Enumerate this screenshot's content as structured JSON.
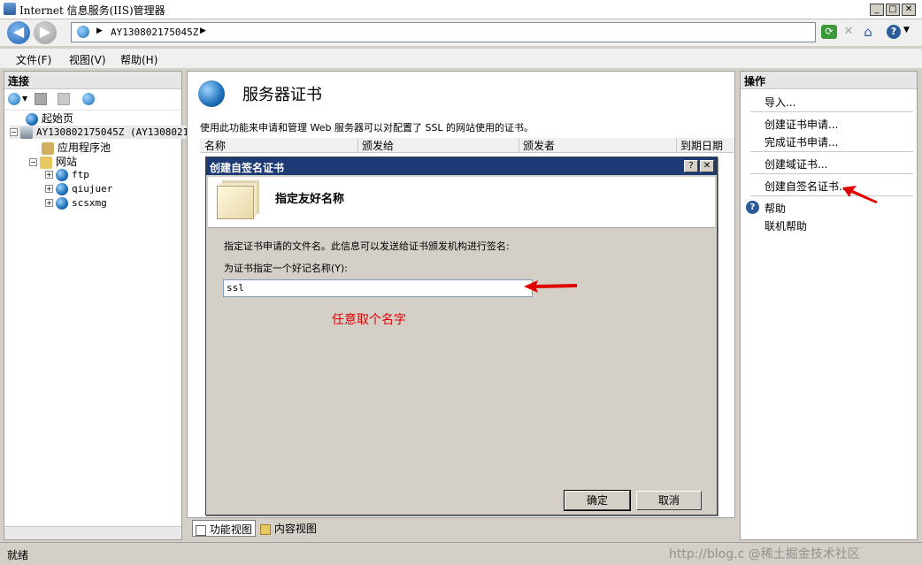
{
  "window": {
    "title": "Internet 信息服务(IIS)管理器"
  },
  "address_bar": {
    "path": "AY130802175045Z"
  },
  "menu": {
    "file": "文件(F)",
    "view": "视图(V)",
    "help": "帮助(H)"
  },
  "connections": {
    "header": "连接",
    "tree": {
      "start_page": "起始页",
      "server": "AY130802175045Z (AY1308021",
      "app_pools": "应用程序池",
      "sites": "网站",
      "site_items": [
        "ftp",
        "qiujuer",
        "scsxmg"
      ]
    }
  },
  "main": {
    "title": "服务器证书",
    "description": "使用此功能来申请和管理 Web 服务器可以对配置了 SSL 的网站使用的证书。",
    "columns": [
      "名称",
      "颁发给",
      "颁发者",
      "到期日期"
    ],
    "view_tabs": {
      "features": "功能视图",
      "content": "内容视图"
    }
  },
  "actions": {
    "header": "操作",
    "import": "导入...",
    "create_request": "创建证书申请...",
    "complete_request": "完成证书申请...",
    "create_domain_cert": "创建域证书...",
    "create_self_signed": "创建自签名证书...",
    "help": "帮助",
    "online_help": "联机帮助"
  },
  "dialog": {
    "title": "创建自签名证书",
    "help_btn": "?",
    "close_btn": "✕",
    "heading": "指定友好名称",
    "instruction": "指定证书申请的文件名。此信息可以发送给证书颁发机构进行签名:",
    "field_label": "为证书指定一个好记名称(Y):",
    "field_value": "ssl",
    "annotation": "任意取个名字",
    "ok": "确定",
    "cancel": "取消"
  },
  "status": {
    "text": "就绪",
    "watermark": "http://blog.c @稀土掘金技术社区"
  },
  "colors": {
    "dialog_title_bg": "#1c3a73",
    "annotation_red": "#e00000",
    "window_bg": "#d4d0c8"
  }
}
